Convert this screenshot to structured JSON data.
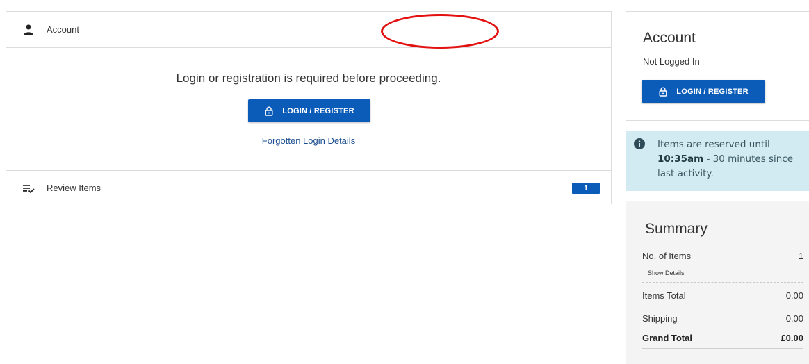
{
  "main": {
    "account_section_label": "Account",
    "required_text": "Login or registration is required before proceeding.",
    "login_button_label": "LOGIN / REGISTER",
    "forgot_link": "Forgotten Login Details",
    "review_section_label": "Review Items",
    "review_count": "1"
  },
  "sidebar": {
    "account": {
      "title": "Account",
      "status": "Not Logged In",
      "login_button_label": "LOGIN / REGISTER"
    },
    "info": {
      "text_prefix": "Items are reserved until ",
      "time": "10:35am",
      "text_suffix": " - 30 minutes since last activity."
    },
    "summary": {
      "title": "Summary",
      "items_label": "No. of Items",
      "items_value": "1",
      "show_details": "Show Details",
      "items_total_label": "Items Total",
      "items_total_value": "0.00",
      "shipping_label": "Shipping",
      "shipping_value": "0.00",
      "grand_total_label": "Grand Total",
      "grand_total_value": "£0.00"
    }
  },
  "colors": {
    "primary_button": "#0b5cb8",
    "info_background": "#d2ebf3",
    "annotation": "#e3110f",
    "summary_background": "#f4f4f4"
  },
  "icons": {
    "account": "person-icon",
    "review": "checklist-icon",
    "lock": "lock-icon",
    "info": "info-icon"
  }
}
